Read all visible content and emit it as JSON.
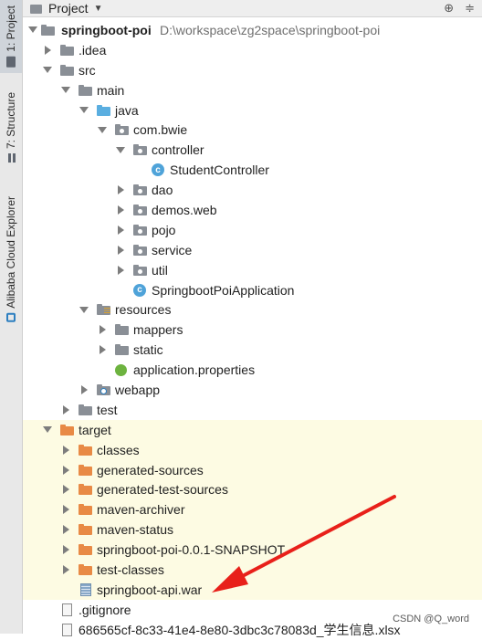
{
  "sidebar": {
    "project_tab": "1: Project",
    "structure_tab": "7: Structure",
    "cloud_tab": "Alibaba Cloud Explorer"
  },
  "header": {
    "title": "Project"
  },
  "tree": {
    "root": {
      "name": "springboot-poi",
      "path": "D:\\workspace\\zg2space\\springboot-poi"
    },
    "idea": ".idea",
    "src": "src",
    "main": "main",
    "java": "java",
    "pkg": "com.bwie",
    "controller": "controller",
    "student_controller": "StudentController",
    "dao": "dao",
    "demos": "demos.web",
    "pojo": "pojo",
    "service": "service",
    "util": "util",
    "app_class": "SpringbootPoiApplication",
    "resources": "resources",
    "mappers": "mappers",
    "static": "static",
    "app_props": "application.properties",
    "webapp": "webapp",
    "test": "test",
    "target": "target",
    "classes": "classes",
    "gen_sources": "generated-sources",
    "gen_test_sources": "generated-test-sources",
    "maven_archiver": "maven-archiver",
    "maven_status": "maven-status",
    "snapshot": "springboot-poi-0.0.1-SNAPSHOT",
    "test_classes": "test-classes",
    "war": "springboot-api.war",
    "gitignore": ".gitignore",
    "xlsx": "686565cf-8c33-41e4-8e80-3dbc3c78083d_学生信息.xlsx"
  },
  "watermark": "CSDN @Q_word",
  "colors": {
    "highlight": "#fdfbe3",
    "annotation_arrow": "#e8201a"
  }
}
